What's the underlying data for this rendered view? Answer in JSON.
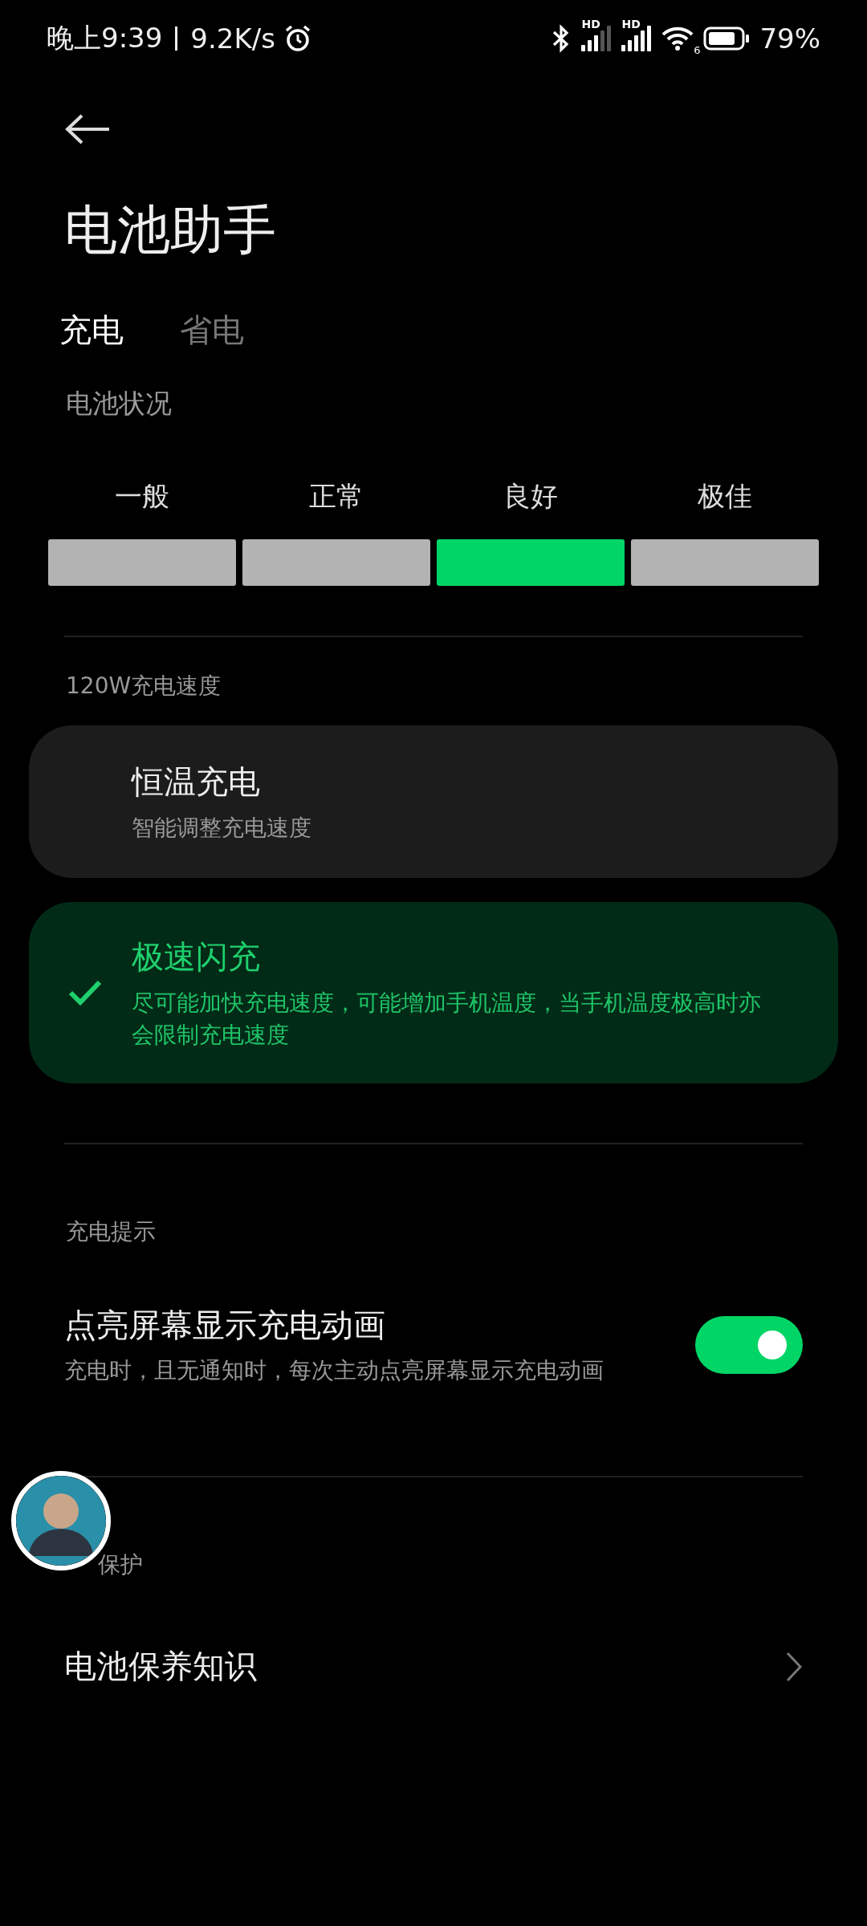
{
  "status_bar": {
    "time": "晚上9:39",
    "speed": "9.2K/s",
    "sim_labels": [
      "HD",
      "HD"
    ],
    "wifi_label": "6",
    "battery": "79%"
  },
  "title": "电池助手",
  "tabs": [
    {
      "label": "充电",
      "selected": true
    },
    {
      "label": "省电",
      "selected": false
    }
  ],
  "health": {
    "heading": "电池状况",
    "levels": [
      {
        "label": "一般",
        "selected": false
      },
      {
        "label": "正常",
        "selected": false
      },
      {
        "label": "良好",
        "selected": true
      },
      {
        "label": "极佳",
        "selected": false
      }
    ]
  },
  "speed_section": {
    "heading": "120W充电速度",
    "options": [
      {
        "title": "恒温充电",
        "description": "智能调整充电速度",
        "selected": false
      },
      {
        "title": "极速闪充",
        "description": "尽可能加快充电速度，可能增加手机温度，当手机温度极高时亦会限制充电速度",
        "selected": true
      }
    ]
  },
  "tips_section": {
    "heading": "充电提示",
    "setting": {
      "title": "点亮屏幕显示充电动画",
      "description": "充电时，且无通知时，每次主动点亮屏幕显示充电动画",
      "on": true
    }
  },
  "protection_section": {
    "heading": "保护",
    "link": "电池保养知识"
  }
}
